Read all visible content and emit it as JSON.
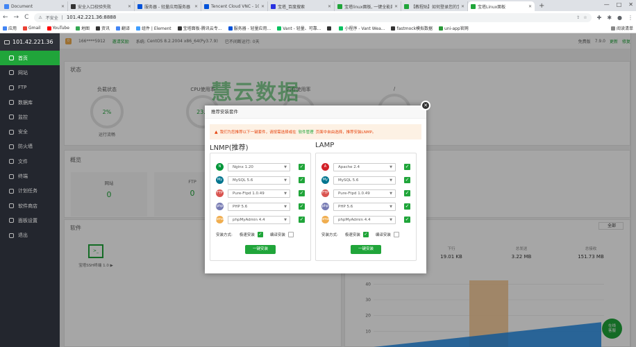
{
  "browser": {
    "tabs": [
      {
        "label": "Document",
        "color": "#4285f4"
      },
      {
        "label": "安全入口校验失败",
        "color": "#333333"
      },
      {
        "label": "服务器 - 轻量应用服务器",
        "color": "#0052d9"
      },
      {
        "label": "Tencent Cloud VNC - 10",
        "color": "#0052d9"
      },
      {
        "label": "宝塔_百度搜索",
        "color": "#2932e1"
      },
      {
        "label": "宝塔linux面板, 一键全能部",
        "color": "#20a53a"
      },
      {
        "label": "【教程贴】如何登录您的宝",
        "color": "#20a53a"
      },
      {
        "label": "宝塔Linux面板",
        "color": "#20a53a"
      }
    ],
    "new_tab": "+",
    "window_controls": [
      "—",
      "□",
      "✕"
    ],
    "nav": {
      "back": "←",
      "forward": "→",
      "reload": "C"
    },
    "security_label": "不安全",
    "url": "101.42.221.36:8888",
    "bookmarks": [
      {
        "label": "应用",
        "color": "#4285f4"
      },
      {
        "label": "Gmail",
        "color": "#ea4335"
      },
      {
        "label": "YouTube",
        "color": "#ff0000"
      },
      {
        "label": "地图",
        "color": "#34a853"
      },
      {
        "label": "资讯",
        "color": "#333333"
      },
      {
        "label": "翻译",
        "color": "#4285f4"
      },
      {
        "label": "组件 | Element",
        "color": "#409eff"
      },
      {
        "label": "宝塔面板-腾讯云专...",
        "color": "#333333"
      },
      {
        "label": "服务器 - 轻量应用...",
        "color": "#0052d9"
      },
      {
        "label": "Vant - 轻量、可靠...",
        "color": "#07c160"
      },
      {
        "label": "",
        "color": "#333333"
      },
      {
        "label": "小程序 - Vant Wea...",
        "color": "#07c160"
      },
      {
        "label": "fastmock模拟数据",
        "color": "#333333"
      },
      {
        "label": "uni-app官网",
        "color": "#2b9939"
      }
    ],
    "reading_list": "阅读清单"
  },
  "sidebar": {
    "host": "101.42.221.36",
    "items": [
      {
        "label": "首页",
        "active": true
      },
      {
        "label": "网站"
      },
      {
        "label": "FTP"
      },
      {
        "label": "数据库"
      },
      {
        "label": "监控"
      },
      {
        "label": "安全"
      },
      {
        "label": "防火墙"
      },
      {
        "label": "文件"
      },
      {
        "label": "终端"
      },
      {
        "label": "计划任务"
      },
      {
        "label": "软件商店"
      },
      {
        "label": "面板设置"
      },
      {
        "label": "退出"
      }
    ]
  },
  "topinfo": {
    "notice_count": "0",
    "user": "166****5912",
    "reward": "邀请奖励",
    "system_label": "系统:",
    "system": "CentOS 8.2.2004 x86_64(Py3.7.9)",
    "uptime": "已不间断运行: 0天",
    "edition": "免费版",
    "version": "7.9.0",
    "update": "更新",
    "repair": "修复"
  },
  "status": {
    "title": "状态",
    "gauges": [
      {
        "label": "负载状态",
        "value": "2%",
        "sub": "运行流畅"
      },
      {
        "label": "CPU使用率",
        "value": "23.4",
        "sub": ""
      },
      {
        "label": "内存使用率",
        "value": "",
        "sub": ""
      },
      {
        "label": "/",
        "value": "",
        "sub": ""
      }
    ]
  },
  "watermark": "慧云数据",
  "overview": {
    "title": "概览",
    "items": [
      {
        "label": "网站",
        "value": "0"
      },
      {
        "label": "FTP",
        "value": "0"
      }
    ]
  },
  "software": {
    "title": "软件",
    "ssh_icon": ">_",
    "ssh_name": "宝塔SSH终端 1.0 ▶"
  },
  "traffic": {
    "all": "全部",
    "stats": [
      {
        "label": "下行",
        "value": "19.01 KB"
      },
      {
        "label": "总发送",
        "value": "3.22 MB"
      },
      {
        "label": "总接收",
        "value": "151.73 MB"
      }
    ]
  },
  "chart_data": {
    "type": "area",
    "y_ticks": [
      "40",
      "30",
      "20",
      "10"
    ],
    "ylim": [
      0,
      45
    ],
    "bar_color": "#f5c58f",
    "line_color": "#1e88e5"
  },
  "modal": {
    "title": "推荐安装套件",
    "close": "✕",
    "warning": {
      "text_before": "我们为您推荐以下一键套件，请按需选择或在",
      "link": "软件管理",
      "text_after": "页面中自由选择，推荐安装LNMP。"
    },
    "stacks": [
      {
        "name": "LNMP(推荐)",
        "rows": [
          {
            "icon": "N",
            "color": "#009639",
            "value": "Nginx 1.20"
          },
          {
            "icon": "My",
            "color": "#00758f",
            "value": "MySQL 5.6"
          },
          {
            "icon": "FTP",
            "color": "#d9534f",
            "value": "Pure-Ftpd 1.0.49"
          },
          {
            "icon": "php",
            "color": "#777bb3",
            "value": "PHP 5.6"
          },
          {
            "icon": "pma",
            "color": "#f0ad4e",
            "value": "phpMyAdmin 4.4"
          }
        ],
        "mode_label": "安装方式:",
        "fast": "极速安装",
        "compile": "编译安装",
        "button": "一键安装"
      },
      {
        "name": "LAMP",
        "rows": [
          {
            "icon": "A",
            "color": "#d22128",
            "value": "Apache 2.4"
          },
          {
            "icon": "My",
            "color": "#00758f",
            "value": "MySQL 5.6"
          },
          {
            "icon": "FTP",
            "color": "#d9534f",
            "value": "Pure-Ftpd 1.0.49"
          },
          {
            "icon": "php",
            "color": "#777bb3",
            "value": "PHP 5.6"
          },
          {
            "icon": "pma",
            "color": "#f0ad4e",
            "value": "phpMyAdmin 4.4"
          }
        ],
        "mode_label": "安装方式:",
        "fast": "极速安装",
        "compile": "编译安装",
        "button": "一键安装"
      }
    ]
  },
  "float_button": "在线\n客服",
  "colors": {
    "brand": "#20a53a",
    "sidebar": "#23262e",
    "warning_bg": "#fdf1e4",
    "warning_text": "#e6440e"
  }
}
